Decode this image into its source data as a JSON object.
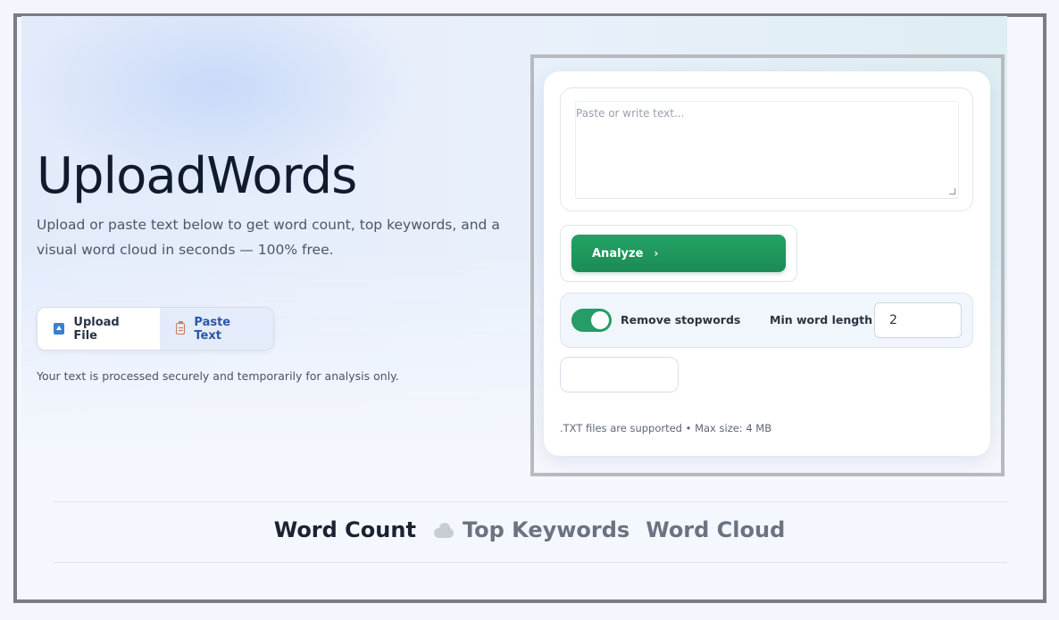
{
  "hero": {
    "title": "UploadWords",
    "subtitle": "Upload or paste text below to get word count, top keywords, and a visual word cloud in seconds — 100% free.",
    "secure_note": "Your text is processed securely and temporarily for analysis only."
  },
  "mode_toggle": {
    "upload_label": "Upload File",
    "paste_label": "Paste Text",
    "active": "Paste Text"
  },
  "panel": {
    "text_placeholder": "Paste or write text...",
    "text_value": "",
    "analyze_label": "Analyze",
    "analyze_chevron": "›",
    "remove_stopwords_label": "Remove stopwords",
    "remove_stopwords_on": true,
    "min_word_length_label": "Min word length",
    "min_word_length_value": "2",
    "file_note": ".TXT files are supported • Max size: 4 MB"
  },
  "tabs": {
    "word_count": "Word Count",
    "top_keywords": "Top Keywords",
    "word_cloud": "Word Cloud"
  },
  "colors": {
    "accent_green": "#23a365",
    "accent_blue": "#2a56a6",
    "title": "#111b2e"
  }
}
